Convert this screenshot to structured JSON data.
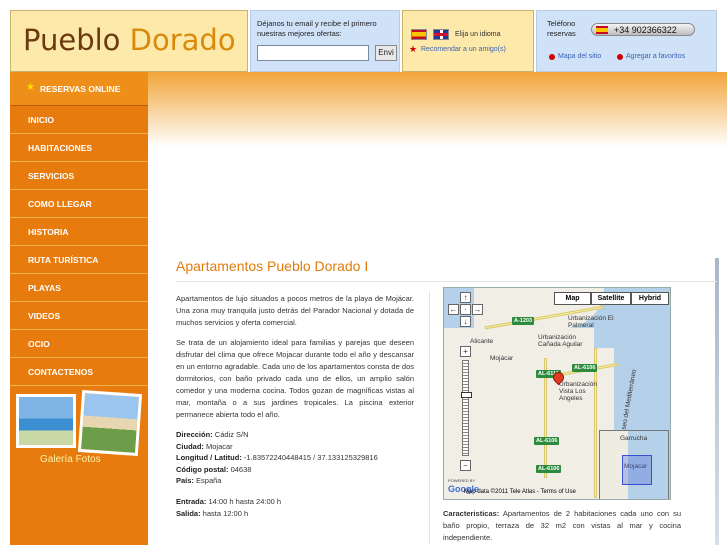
{
  "logo": {
    "part1": "Pueblo",
    "part2": "Dorado"
  },
  "newsletter": {
    "text": "Déjanos tu email y recibe el primero nuestras mejores ofertas:",
    "input_value": "",
    "button_label": "Envi"
  },
  "language": {
    "label": "Elija un idioma",
    "recommend": "Recomendar a un amigo(s)"
  },
  "contact": {
    "phone_label": "Teléfono reservas",
    "phone": "+34 902366322",
    "sitemap": "Mapa del sitio",
    "favorites": "Agregar a favoritos"
  },
  "sidebar": {
    "reservas": "RESERVAS ONLINE",
    "items": [
      {
        "label": "INICIO"
      },
      {
        "label": "HABITACIONES"
      },
      {
        "label": "SERVICIOS"
      },
      {
        "label": "COMO LLEGAR"
      },
      {
        "label": "HISTORIA"
      },
      {
        "label": "RUTA TURÍSTICA"
      },
      {
        "label": "PLAYAS"
      },
      {
        "label": "VIDEOS"
      },
      {
        "label": "OCIO"
      },
      {
        "label": "CONTACTENOS"
      }
    ],
    "gallery": "Galería Fotos"
  },
  "main": {
    "title": "Apartamentos Pueblo Dorado I",
    "p1": "Apartamentos de lujo situados a pocos metros de la playa de Mojácar. Una zona muy tranquila justo detrás del Parador Nacional y dotada de muchos servicios y oferta comercial.",
    "p2": "Se trata de un alojamiento ideal para familias y parejas que deseen disfrutar del clima que ofrece Mojacar durante todo el año y descansar en un entorno agradable. Cada uno de los apartamentos consta de dos dormitorios, con baño privado cada uno de ellos, un amplio salón comedor y una moderna cocina. Todos gozan de magníficas vistas al mar, montaña o a sus jardines tropicales. La piscina exterior permanece abierta todo el año.",
    "info": [
      {
        "k": "Dirección:",
        "v": " Cádiz S/N"
      },
      {
        "k": "Ciudad:",
        "v": " Mojacar"
      },
      {
        "k": "Longitud / Latitud:",
        "v": " -1.83572240448415 / 37.133125329816"
      },
      {
        "k": "Código postal:",
        "v": " 04638"
      },
      {
        "k": "País:",
        "v": " España"
      }
    ],
    "times": [
      {
        "k": "Entrada:",
        "v": " 14:00 h hasta 24:00 h"
      },
      {
        "k": "Salida:",
        "v": " hasta 12:00 h"
      }
    ],
    "caract_k": "Caracteristicas:",
    "caract_v": " Apartamentos de 2 habitaciones cada uno con su baño propio, terraza de 32 m2 con vistas al mar y cocina independiente."
  },
  "map": {
    "buttons": [
      "Map",
      "Satellite",
      "Hybrid"
    ],
    "selected": "Map",
    "zoom_level": 0.35,
    "labels": {
      "urb1": "Urbanización El Palmeral",
      "urb2": "Urbanización Cañada Aguilar",
      "mojacar": "Mojácar",
      "urb3": "Urbanización Vista Los Angeles",
      "paseo": "Paseo del Mediterráneo",
      "garrucha": "Garrucha",
      "mini_mojacar": "Mojacar",
      "alicante": "Alicante"
    },
    "roads": [
      "A-1203",
      "AL-6111",
      "AL-6106",
      "AL-6106",
      "AL-6106"
    ],
    "powered": "POWERED BY",
    "google": "Google",
    "data": "Map data ©2011 Tele Atlas - Terms of Use"
  }
}
